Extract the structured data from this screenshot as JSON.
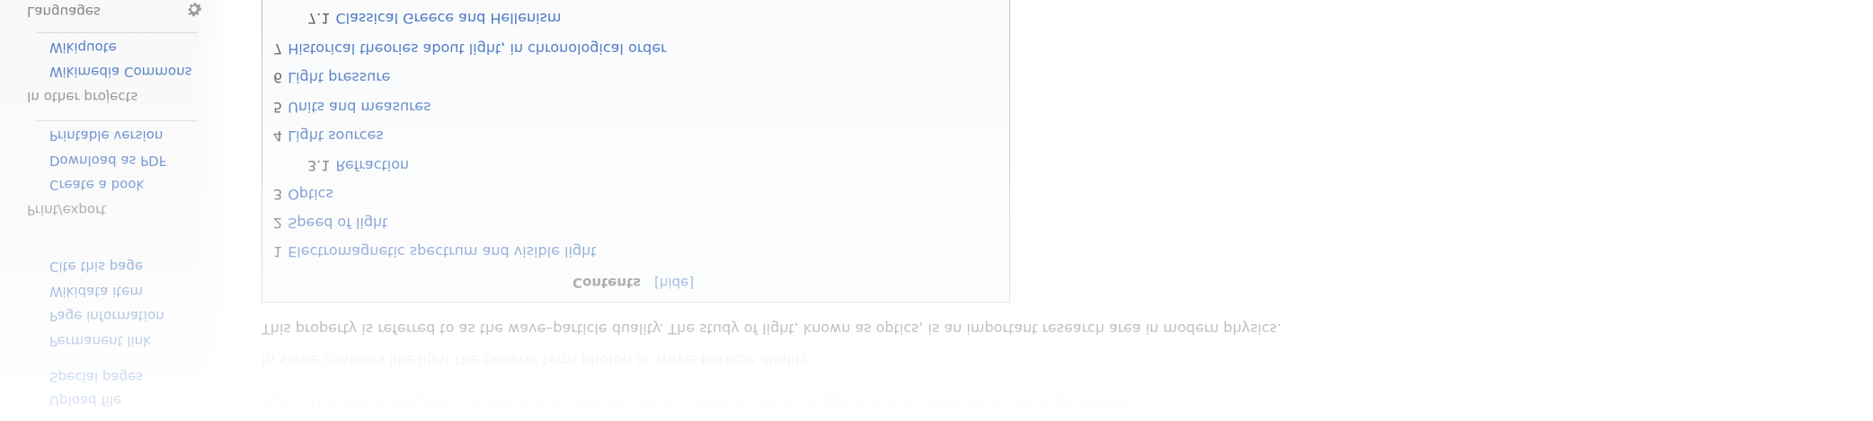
{
  "sidebar": {
    "tools_items": [
      "Cite this page",
      "Wikidata item",
      "Page information",
      "Permanent link",
      "Special pages",
      "Upload file"
    ],
    "print_export": {
      "heading": "Print/export",
      "items": [
        "Create a book",
        "Download as PDF",
        "Printable version"
      ]
    },
    "other_projects": {
      "heading": "In other projects",
      "items": [
        "Wikimedia Commons",
        "Wikiquote"
      ]
    },
    "languages": {
      "heading": "Languages",
      "settings_icon": "gear-icon"
    }
  },
  "toc": {
    "title": "Contents",
    "toggle": "[hide]",
    "items": [
      {
        "num": "1",
        "label": "Electromagnetic spectrum and visible light"
      },
      {
        "num": "2",
        "label": "Speed of light"
      },
      {
        "num": "3",
        "label": "Optics"
      },
      {
        "num": "3.1",
        "label": "Refraction"
      },
      {
        "num": "4",
        "label": "Light sources"
      },
      {
        "num": "5",
        "label": "Units and measures"
      },
      {
        "num": "6",
        "label": "Light pressure"
      },
      {
        "num": "7",
        "label": "Historical theories about light, in chronological order"
      },
      {
        "num": "7.1",
        "label": "Classical Greece and Hellenism"
      }
    ]
  },
  "body": {
    "paragraph_line_1": "This property is referred to as the wave–particle duality. The study of light, known as optics, is an important research area in modern physics.",
    "paragraph_line_2": "In some contexts like light the general term photon or wave–particle duality.",
    "paragraph_line_3": "light, other electromagnetic radiation are used and the the particle nature of light was first observed in the experiments."
  },
  "colors": {
    "link": "#0645ad",
    "text": "#202122",
    "sidebar_bg": "#f6f6f6",
    "toc_bg": "#f8f9fa",
    "toc_border": "#a2a9b1"
  }
}
